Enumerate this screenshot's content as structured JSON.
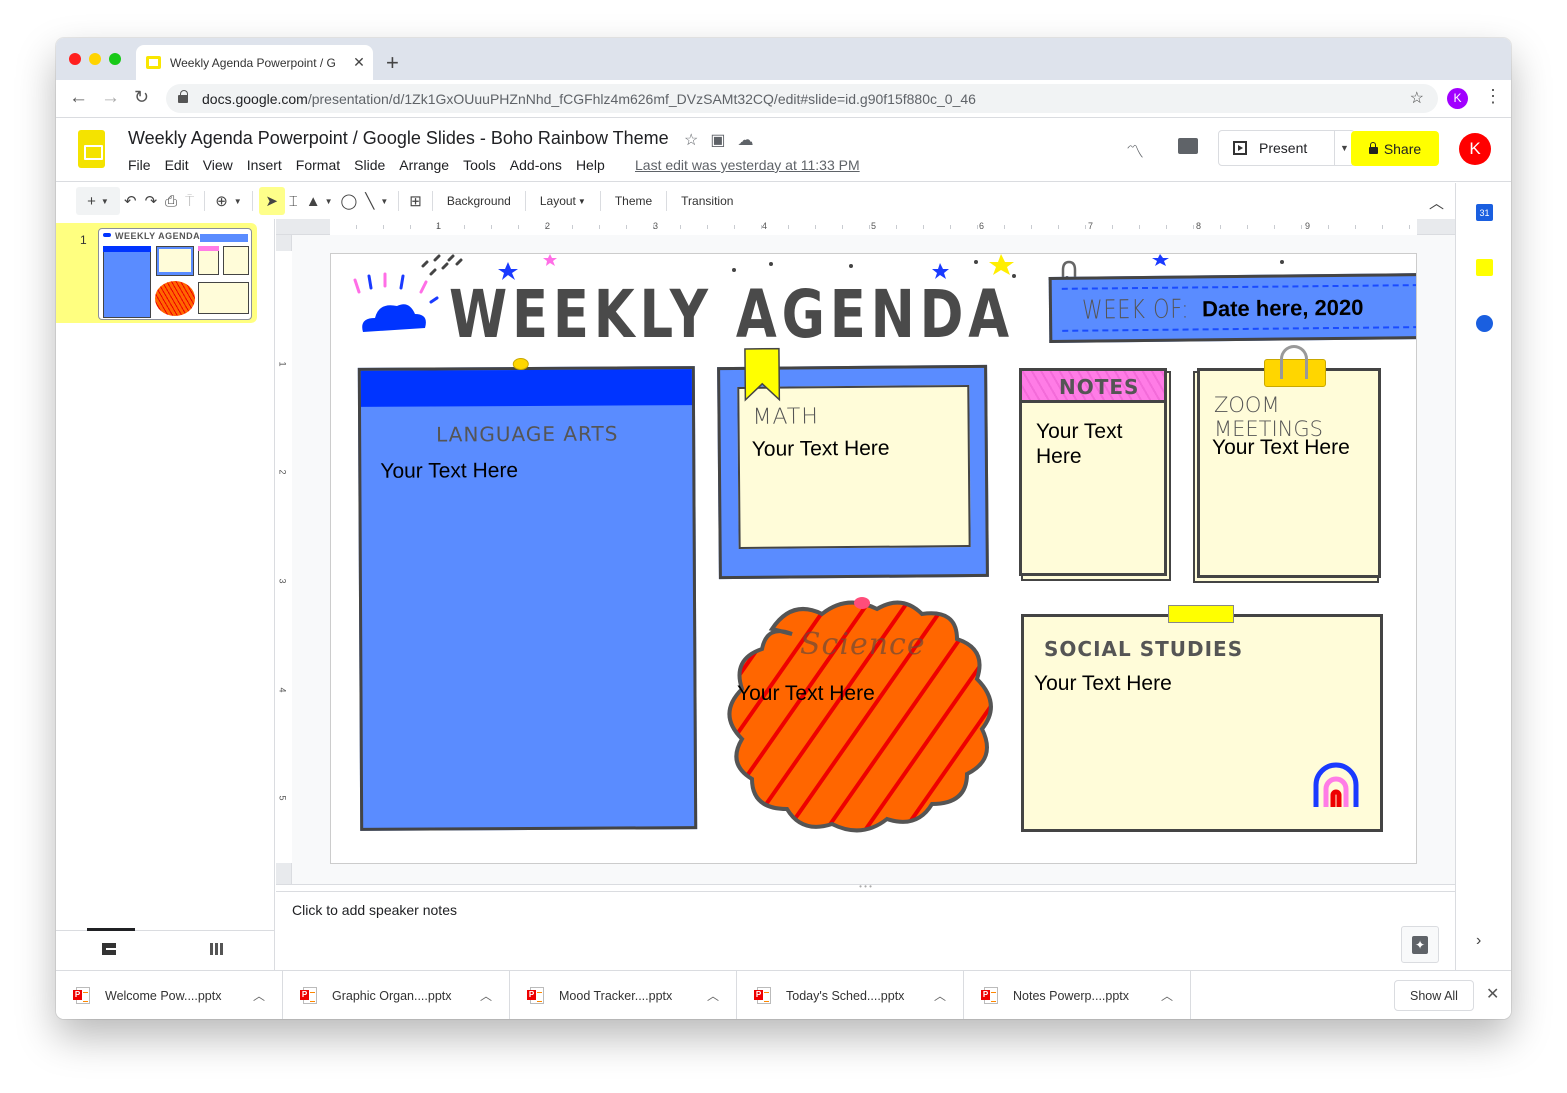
{
  "browser": {
    "tab_title": "Weekly Agenda Powerpoint / Google Slides - Boho Rainbow Theme",
    "tab_title_visible": "Weekly Agenda Powerpoint / G",
    "new_tab_label": "+",
    "url_host": "docs.google.com",
    "url_path": "/presentation/d/1Zk1GxOUuuPHZnNhd_fCGFhlz4m626mf_DVzSAMt32CQ/edit#slide=id.g90f15f880c_0_46",
    "profile_initial": "K",
    "profile_color": "#a100ff"
  },
  "doc": {
    "title": "Weekly Agenda Powerpoint / Google Slides - Boho Rainbow Theme",
    "menu": [
      "File",
      "Edit",
      "View",
      "Insert",
      "Format",
      "Slide",
      "Arrange",
      "Tools",
      "Add-ons",
      "Help"
    ],
    "last_edit": "Last edit was yesterday at 11:33 PM",
    "present_label": "Present",
    "share_label": "Share",
    "share_color": "#ffff00",
    "account_initial": "K",
    "account_color": "#ff0000"
  },
  "toolbar": {
    "background": "Background",
    "layout": "Layout",
    "theme": "Theme",
    "transition": "Transition"
  },
  "ruler": {
    "horizontal": [
      "1",
      "2",
      "3",
      "4",
      "5",
      "6",
      "7",
      "8",
      "9"
    ],
    "vertical": [
      "1",
      "2",
      "3",
      "4",
      "5"
    ]
  },
  "filmstrip": {
    "slides": [
      {
        "number": "1"
      }
    ]
  },
  "slide": {
    "title": "WEEKLY AGENDA",
    "week_of_label": "WEEK OF:",
    "week_date": "Date here, 2020",
    "boxes": {
      "language_arts": {
        "title": "LANGUAGE ARTS",
        "text": "Your Text Here"
      },
      "math": {
        "title": "MATH",
        "text": "Your Text Here"
      },
      "notes": {
        "title": "NOTES",
        "text": "Your Text Here"
      },
      "zoom": {
        "title": "ZOOM MEETINGS",
        "text": "Your Text Here"
      },
      "science": {
        "title": "Science",
        "text": "Your Text Here"
      },
      "social_studies": {
        "title": "SOCIAL STUDIES",
        "text": "Your Text Here"
      }
    },
    "colors": {
      "blue": "#5a8cff",
      "dark_blue": "#0034ff",
      "cream": "#fffcd9",
      "pink": "#ff7ce6",
      "orange": "#ff6600",
      "stripe_red": "#ee0000",
      "yellow": "#ffff00"
    }
  },
  "notes": {
    "placeholder": "Click to add speaker notes"
  },
  "downloads": {
    "items": [
      {
        "name": "Welcome Pow....pptx"
      },
      {
        "name": "Graphic Organ....pptx"
      },
      {
        "name": "Mood Tracker....pptx"
      },
      {
        "name": "Today's Sched....pptx"
      },
      {
        "name": "Notes Powerp....pptx"
      }
    ],
    "show_all": "Show All"
  }
}
